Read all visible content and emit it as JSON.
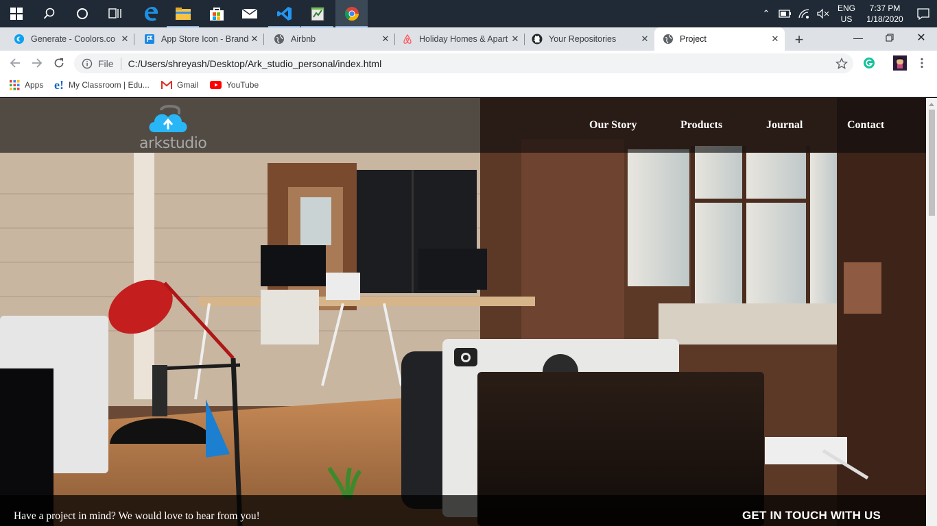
{
  "taskbar": {
    "tray": {
      "lang_line1": "ENG",
      "lang_line2": "US",
      "time": "7:37 PM",
      "date": "1/18/2020"
    }
  },
  "tabs": [
    {
      "title": "Generate - Coolors.co",
      "icon": "coolors-icon"
    },
    {
      "title": "App Store Icon - Brands",
      "icon": "flag-icon"
    },
    {
      "title": "Airbnb",
      "icon": "globe-icon"
    },
    {
      "title": "Holiday Homes & Apart",
      "icon": "airbnb-icon"
    },
    {
      "title": "Your Repositories",
      "icon": "github-icon"
    },
    {
      "title": "Project",
      "icon": "globe-icon",
      "active": true
    }
  ],
  "omnibox": {
    "scheme": "File",
    "url": "C:/Users/shreyash/Desktop/Ark_studio_personal/index.html"
  },
  "bookmarks": [
    {
      "label": "Apps",
      "icon": "apps-grid-icon"
    },
    {
      "label": "My Classroom | Edu...",
      "icon": "edureka-icon"
    },
    {
      "label": "Gmail",
      "icon": "gmail-icon"
    },
    {
      "label": "YouTube",
      "icon": "youtube-icon"
    }
  ],
  "site": {
    "logo_text": "arkstudio",
    "nav": [
      "Our Story",
      "Products",
      "Journal",
      "Contact"
    ],
    "footer_text": "Have a project in mind? We would love to hear from you!",
    "cta": "GET IN TOUCH WITH US"
  },
  "colors": {
    "taskbar": "#1f2a36",
    "tabstrip": "#dee1e6",
    "accent": "#1a73e8",
    "logo_cloud": "#29b6f6"
  }
}
